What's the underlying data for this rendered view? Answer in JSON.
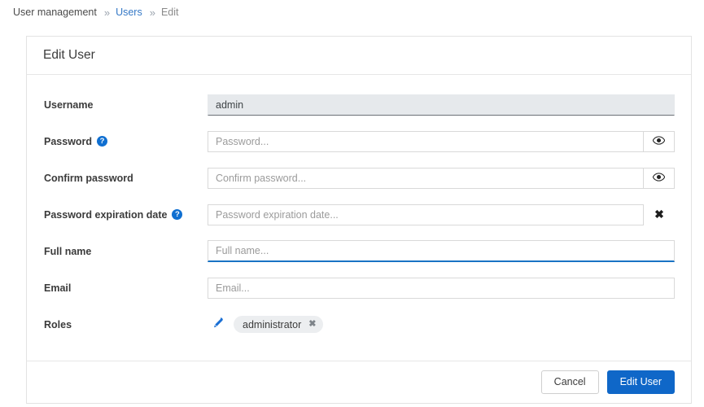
{
  "breadcrumb": {
    "root": "User management",
    "separator": "»",
    "items": [
      {
        "label": "Users",
        "type": "link"
      },
      {
        "label": "Edit",
        "type": "current"
      }
    ]
  },
  "card": {
    "title": "Edit User",
    "fields": {
      "username": {
        "label": "Username",
        "value": "admin",
        "state": "disabled"
      },
      "password": {
        "label": "Password",
        "placeholder": "Password...",
        "help_icon": "?",
        "addon_icon": "eye-icon"
      },
      "confirm_password": {
        "label": "Confirm password",
        "placeholder": "Confirm password...",
        "addon_icon": "eye-icon"
      },
      "password_expiration_date": {
        "label": "Password expiration date",
        "placeholder": "Password expiration date...",
        "help_icon": "?",
        "addon_icon": "clear-icon",
        "addon_glyph": "✖"
      },
      "full_name": {
        "label": "Full name",
        "placeholder": "Full name...",
        "state": "focused"
      },
      "email": {
        "label": "Email",
        "placeholder": "Email..."
      },
      "roles": {
        "label": "Roles",
        "edit_icon": "pencil-icon",
        "tags": [
          {
            "label": "administrator",
            "remove_glyph": "✖"
          }
        ]
      }
    },
    "footer": {
      "cancel_label": "Cancel",
      "submit_label": "Edit User"
    }
  },
  "colors": {
    "primary": "#0f67c8",
    "link": "#3478c6",
    "help_icon": "#0f6fd1",
    "focus_underline": "#1a73c4",
    "disabled_bg": "#e6e9ec",
    "tag_bg": "#eceef0"
  }
}
